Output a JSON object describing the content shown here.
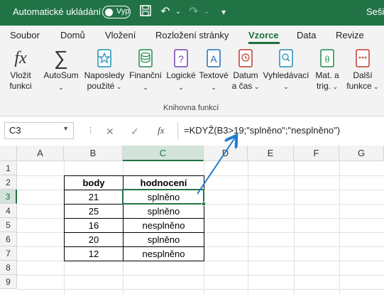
{
  "titlebar": {
    "autosave_label": "Automatické ukládání",
    "toggle_state": "Vyp",
    "filename": "Sešit"
  },
  "tabs": [
    "Soubor",
    "Domů",
    "Vložení",
    "Rozložení stránky",
    "Vzorce",
    "Data",
    "Revize"
  ],
  "active_tab": "Vzorce",
  "ribbon": {
    "buttons": [
      {
        "line1": "Vložit",
        "line2": "funkci",
        "icon": "fx-icon"
      },
      {
        "line1": "AutoSum",
        "line2": "",
        "icon": "sigma-icon"
      },
      {
        "line1": "Naposledy",
        "line2": "použité",
        "icon": "star-icon"
      },
      {
        "line1": "Finanční",
        "line2": "",
        "icon": "coins-icon"
      },
      {
        "line1": "Logické",
        "line2": "",
        "icon": "question-book-icon"
      },
      {
        "line1": "Textové",
        "line2": "",
        "icon": "text-book-icon"
      },
      {
        "line1": "Datum",
        "line2": "a čas",
        "icon": "clock-book-icon"
      },
      {
        "line1": "Vyhledávací",
        "line2": "",
        "icon": "search-book-icon"
      },
      {
        "line1": "Mat. a",
        "line2": "trig.",
        "icon": "theta-book-icon"
      },
      {
        "line1": "Další",
        "line2": "funkce",
        "icon": "more-book-icon"
      }
    ],
    "group_label": "Knihovna funkcí"
  },
  "formula_bar": {
    "cell_ref": "C3",
    "fx_label": "fx",
    "formula": "=KDYŽ(B3>19;\"splněno\";\"nesplněno\")"
  },
  "grid": {
    "columns": [
      "A",
      "B",
      "C",
      "D",
      "E",
      "F",
      "G"
    ],
    "rows": [
      "1",
      "2",
      "3",
      "4",
      "5",
      "6",
      "7",
      "8",
      "9"
    ],
    "selected_column": "C",
    "selected_row": "3"
  },
  "table": {
    "headers": [
      "body",
      "hodnocení"
    ],
    "rows": [
      [
        "21",
        "splněno"
      ],
      [
        "25",
        "splněno"
      ],
      [
        "16",
        "nesplněno"
      ],
      [
        "20",
        "splněno"
      ],
      [
        "12",
        "nesplněno"
      ]
    ]
  },
  "colors": {
    "excel_green": "#217346",
    "arrow_blue": "#1f7bd1"
  }
}
